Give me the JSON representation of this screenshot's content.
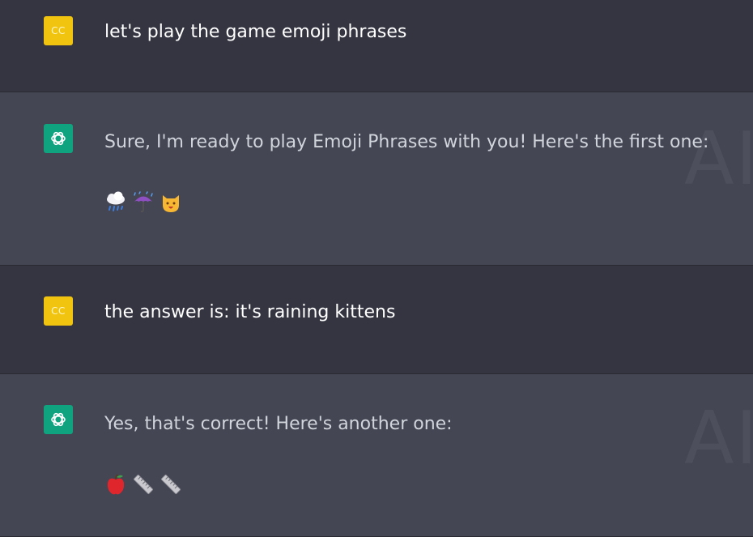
{
  "messages": [
    {
      "role": "user",
      "avatar": "CC",
      "text": "let's play the game emoji phrases"
    },
    {
      "role": "assistant",
      "text": "Sure, I'm ready to play Emoji Phrases with you! Here's the first one:",
      "emojis": [
        "cloud-with-rain",
        "umbrella-with-rain",
        "cat-face"
      ]
    },
    {
      "role": "user",
      "avatar": "CC",
      "text": "the answer is: it's raining kittens"
    },
    {
      "role": "assistant",
      "text": "Yes, that's correct! Here's another one:",
      "emojis": [
        "red-apple",
        "straight-ruler",
        "straight-ruler"
      ]
    }
  ],
  "watermark": "AI",
  "colors": {
    "user_bg": "#343541",
    "assistant_bg": "#444654",
    "user_avatar": "#f1c40f",
    "assistant_avatar": "#10a37f"
  }
}
